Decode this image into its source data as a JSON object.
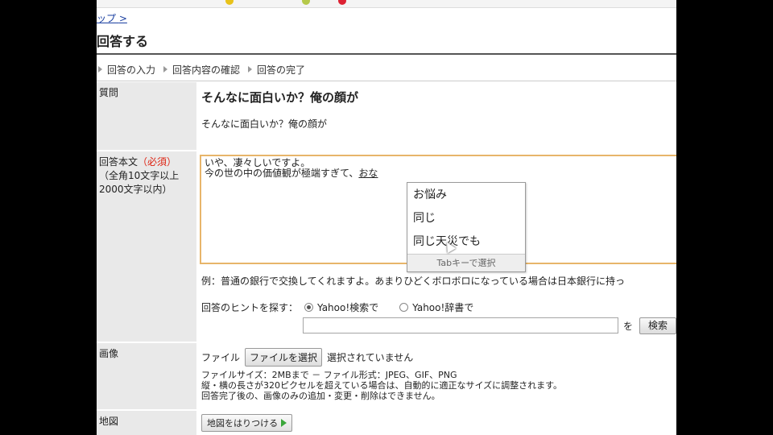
{
  "breadcrumb": {
    "label": "ップ",
    "sep": ">"
  },
  "page": {
    "title": "回答する"
  },
  "steps": [
    {
      "label": "回答の入力"
    },
    {
      "label": "回答内容の確認"
    },
    {
      "label": "回答の完了"
    }
  ],
  "question": {
    "label": "質問",
    "title": "そんなに面白いか？俺の顔が",
    "body": "そんなに面白いか？俺の顔が"
  },
  "answer": {
    "label": "回答本文",
    "required": "（必須）",
    "constraint_line1": "（全角10文字以上",
    "constraint_line2": "2000文字以内）",
    "line1": "いや、凄々しいですよ。",
    "line2_prefix": "今の世の中の価値観が極端すぎて、",
    "composing": "おな"
  },
  "ime": {
    "candidates": [
      "お悩み",
      "同じ",
      "同じ天災でも"
    ],
    "footer": "Tabキーで選択"
  },
  "example": "例：普通の銀行で交換してくれますよ。あまりひどくボロボロになっている場合は日本銀行に持っ",
  "hint": {
    "label": "回答のヒントを探す：",
    "option_web": "Yahoo!検索で",
    "option_dict": "Yahoo!辞書で",
    "wo": "を",
    "search_button": "検索"
  },
  "image": {
    "label": "画像",
    "file_label": "ファイル",
    "choose_button": "ファイルを選択",
    "no_file": "選択されていません",
    "note1": "ファイルサイズ：2MBまで － ファイル形式：JPEG、GIF、PNG",
    "note2": "縦・横の長さが320ピクセルを超えている場合は、自動的に適正なサイズに調整されます。",
    "note3": "回答完了後の、画像のみの追加・変更・削除はできません。"
  },
  "map": {
    "label": "地図",
    "attach_button": "地図をはりつける"
  },
  "colors": {
    "required": "#dd2211",
    "textarea_border": "#e7b56a",
    "label_bg": "#e9e9e9"
  }
}
